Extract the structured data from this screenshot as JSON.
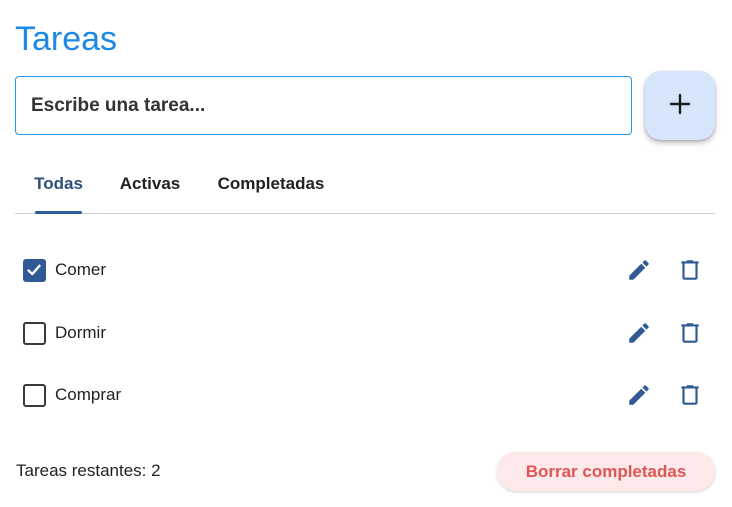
{
  "header": {
    "title": "Tareas"
  },
  "new_task": {
    "placeholder": "Escribe una tarea...",
    "value": ""
  },
  "add_button": {
    "icon": "plus-icon"
  },
  "tabs": [
    {
      "label": "Todas",
      "active": true
    },
    {
      "label": "Activas",
      "active": false
    },
    {
      "label": "Completadas",
      "active": false
    }
  ],
  "tasks": [
    {
      "label": "Comer",
      "completed": true
    },
    {
      "label": "Dormir",
      "completed": false
    },
    {
      "label": "Comprar",
      "completed": false
    }
  ],
  "task_actions": {
    "edit_icon": "pencil-icon",
    "delete_icon": "trash-icon"
  },
  "footer": {
    "remaining": "Tareas restantes: 2",
    "clear_label": "Borrar completadas"
  },
  "colors": {
    "accent": "#1e88e5",
    "primary_dark": "#2f5a94",
    "danger": "#e05555",
    "danger_bg": "#fde9ea",
    "fab_bg": "#d6e5fb"
  }
}
